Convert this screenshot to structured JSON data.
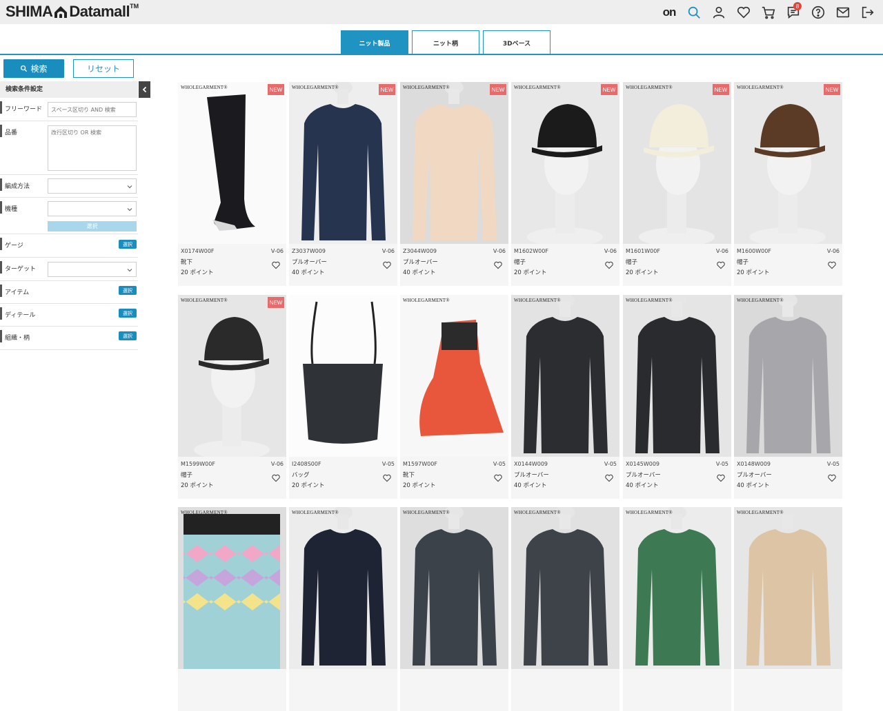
{
  "header": {
    "logo_text_left": "SHIMA",
    "logo_text_right": "Datamall",
    "logo_tm": "TM",
    "on_label": "on",
    "notification_count": "8",
    "accent_color": "#1f93c2"
  },
  "tabs": [
    {
      "label": "ニット製品",
      "active": true
    },
    {
      "label": "ニット柄",
      "active": false
    },
    {
      "label": "3Dベース",
      "active": false
    }
  ],
  "sidebar": {
    "search_label": "検索",
    "reset_label": "リセット",
    "title": "検索条件設定",
    "freeword_label": "フリーワード",
    "freeword_placeholder": "スペース区切り AND 検索",
    "partno_label": "品番",
    "partno_placeholder": "改行区切り OR 検索",
    "knit_method_label": "編成方法",
    "machine_label": "機種",
    "select_label": "選択",
    "gauge_label": "ゲージ",
    "target_label": "ターゲット",
    "item_label": "アイテム",
    "detail_label": "ディテール",
    "structure_label": "組織・柄"
  },
  "products": [
    {
      "code": "X0174W00F",
      "version": "V-06",
      "category": "靴下",
      "points": "20 ポイント",
      "brand": "WHOLEGARMENT®",
      "new": "NEW",
      "img": "sock-icon"
    },
    {
      "code": "Z3037W009",
      "version": "V-06",
      "category": "プルオーバー",
      "points": "40 ポイント",
      "brand": "WHOLEGARMENT®",
      "new": "NEW",
      "img": "sweater-navy"
    },
    {
      "code": "Z3044W009",
      "version": "V-06",
      "category": "プルオーバー",
      "points": "40 ポイント",
      "brand": "WHOLEGARMENT®",
      "new": "NEW",
      "img": "sweater-beige"
    },
    {
      "code": "M1602W00F",
      "version": "V-06",
      "category": "帽子",
      "points": "20 ポイント",
      "brand": "WHOLEGARMENT®",
      "new": "NEW",
      "img": "bucket-hat"
    },
    {
      "code": "M1601W00F",
      "version": "V-06",
      "category": "帽子",
      "points": "20 ポイント",
      "brand": "WHOLEGARMENT®",
      "new": "NEW",
      "img": "cap-white"
    },
    {
      "code": "M1600W00F",
      "version": "V-06",
      "category": "帽子",
      "points": "20 ポイント",
      "brand": "WHOLEGARMENT®",
      "new": "NEW",
      "img": "cap-brown"
    },
    {
      "code": "M1599W00F",
      "version": "V-06",
      "category": "帽子",
      "points": "20 ポイント",
      "brand": "WHOLEGARMENT®",
      "new": "NEW",
      "img": "cap-pattern"
    },
    {
      "code": "I2408S00F",
      "version": "V-05",
      "category": "バッグ",
      "points": "20 ポイント",
      "brand": "",
      "new": "",
      "img": "bag"
    },
    {
      "code": "M1597W00F",
      "version": "V-05",
      "category": "靴下",
      "points": "20 ポイント",
      "brand": "WHOLEGARMENT®",
      "new": "",
      "img": "toe-sock"
    },
    {
      "code": "X0144W009",
      "version": "V-05",
      "category": "プルオーバー",
      "points": "40 ポイント",
      "brand": "WHOLEGARMENT®",
      "new": "",
      "img": "sweater-dark"
    },
    {
      "code": "X0145W009",
      "version": "V-05",
      "category": "プルオーバー",
      "points": "40 ポイント",
      "brand": "WHOLEGARMENT®",
      "new": "",
      "img": "sweater-dark2"
    },
    {
      "code": "X0148W009",
      "version": "V-05",
      "category": "プルオーバー",
      "points": "40 ポイント",
      "brand": "WHOLEGARMENT®",
      "new": "",
      "img": "sweater-grey"
    },
    {
      "code": "",
      "version": "",
      "category": "",
      "points": "",
      "brand": "WHOLEGARMENT®",
      "new": "",
      "img": "swatch-zigzag"
    },
    {
      "code": "",
      "version": "",
      "category": "",
      "points": "",
      "brand": "WHOLEGARMENT®",
      "new": "",
      "img": "sweater-navy2"
    },
    {
      "code": "",
      "version": "",
      "category": "",
      "points": "",
      "brand": "WHOLEGARMENT®",
      "new": "",
      "img": "sweater-slate"
    },
    {
      "code": "",
      "version": "",
      "category": "",
      "points": "",
      "brand": "WHOLEGARMENT®",
      "new": "",
      "img": "sweater-slate2"
    },
    {
      "code": "",
      "version": "",
      "category": "",
      "points": "",
      "brand": "WHOLEGARMENT®",
      "new": "",
      "img": "sweater-stripe"
    },
    {
      "code": "",
      "version": "",
      "category": "",
      "points": "",
      "brand": "WHOLEGARMENT®",
      "new": "",
      "img": "sweater-camel"
    }
  ]
}
